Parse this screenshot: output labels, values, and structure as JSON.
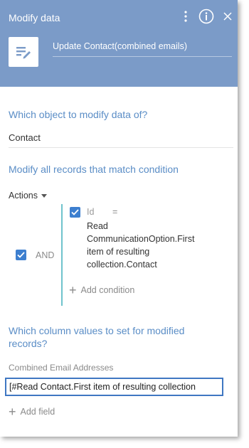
{
  "header": {
    "title": "Modify data",
    "task_name": "Update Contact(combined emails)"
  },
  "object_section": {
    "title": "Which object to modify data of?",
    "value": "Contact"
  },
  "condition_section": {
    "title": "Modify all records that match condition",
    "actions_label": "Actions",
    "group_operator": "AND",
    "condition": {
      "field": "Id",
      "operator": "=",
      "value": "Read CommunicationOption.First item of resulting collection.Contact"
    },
    "add_condition_label": "Add condition"
  },
  "columns_section": {
    "title": "Which column values to set for modified records?",
    "column_label": "Combined Email Addresses",
    "column_value": "[#Read Contact.First item of resulting collection",
    "add_field_label": "Add field"
  },
  "colors": {
    "header_bg": "#7b9bc8",
    "accent": "#5a8dc6",
    "checkbox": "#3d7fcf",
    "group_line": "#6fc3cc",
    "focus_border": "#3f77c2"
  }
}
